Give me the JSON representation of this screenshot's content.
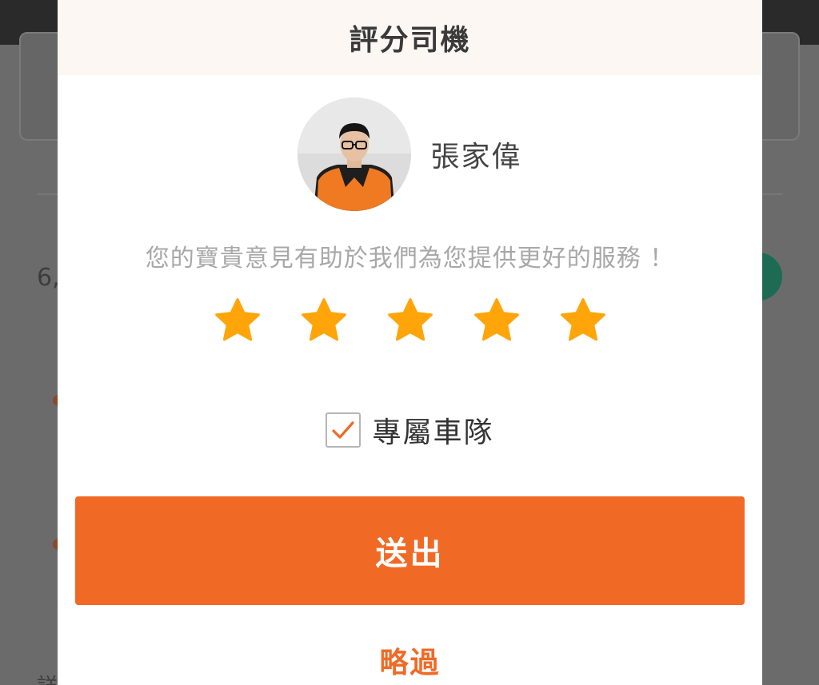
{
  "background": {
    "left_text": "6,",
    "bottom_text": "詳"
  },
  "modal": {
    "title": "評分司機",
    "driver": {
      "name": "張家偉",
      "avatar_icon": "driver-avatar"
    },
    "subtitle": "您的寶貴意見有助於我們為您提供更好的服務 ！",
    "rating": {
      "max": 5,
      "selected": 5,
      "star_color": "#ffa50a"
    },
    "fleet_checkbox": {
      "label": "專屬車隊",
      "checked": true
    },
    "submit_label": "送出",
    "skip_label": "略過"
  },
  "colors": {
    "accent": "#f06a26",
    "header_bg": "#fdf7f3",
    "overlay": "#6b6b6b"
  }
}
